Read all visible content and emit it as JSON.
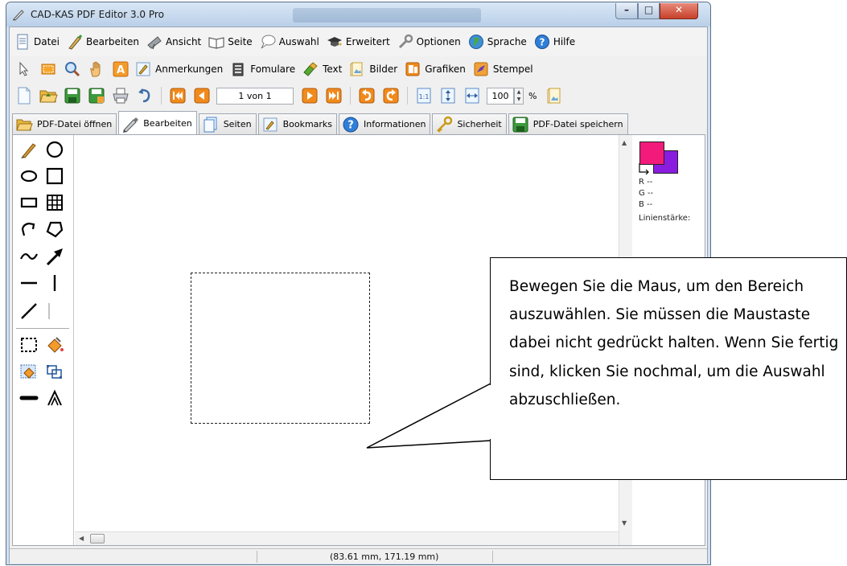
{
  "window": {
    "title": "CAD-KAS PDF Editor 3.0 Pro",
    "controls": [
      "minimize-icon",
      "maximize-icon",
      "close-icon"
    ]
  },
  "menu": [
    {
      "label": "Datei",
      "icon": "file-icon"
    },
    {
      "label": "Bearbeiten",
      "icon": "brush-icon"
    },
    {
      "label": "Ansicht",
      "icon": "telescope-icon"
    },
    {
      "label": "Seite",
      "icon": "book-icon"
    },
    {
      "label": "Auswahl",
      "icon": "speech-bubble-icon"
    },
    {
      "label": "Erweitert",
      "icon": "graduation-cap-icon"
    },
    {
      "label": "Optionen",
      "icon": "wrench-icon"
    },
    {
      "label": "Sprache",
      "icon": "globe-icon"
    },
    {
      "label": "Hilfe",
      "icon": "help-icon"
    }
  ],
  "toolbar1": {
    "icon_tools": [
      "cursor-icon",
      "rectangle-select-icon",
      "zoom-icon",
      "hand-icon",
      "text-a-icon"
    ],
    "labeled": [
      {
        "label": "Anmerkungen",
        "icon": "annotation-icon"
      },
      {
        "label": "Fomulare",
        "icon": "form-icon"
      },
      {
        "label": "Text",
        "icon": "text-tool-icon"
      },
      {
        "label": "Bilder",
        "icon": "image-icon"
      },
      {
        "label": "Grafiken",
        "icon": "graphics-icon"
      },
      {
        "label": "Stempel",
        "icon": "stamp-icon"
      }
    ]
  },
  "toolbar2": {
    "page_display": "1 von 1",
    "zoom_value": "100",
    "zoom_unit": "%"
  },
  "tabs": [
    {
      "label": "PDF-Datei öffnen",
      "icon": "folder-open-icon",
      "active": false
    },
    {
      "label": "Bearbeiten",
      "icon": "pencil-icon",
      "active": true
    },
    {
      "label": "Seiten",
      "icon": "pages-icon",
      "active": false
    },
    {
      "label": "Bookmarks",
      "icon": "bookmark-icon",
      "active": false
    },
    {
      "label": "Informationen",
      "icon": "info-icon",
      "active": false
    },
    {
      "label": "Sicherheit",
      "icon": "key-icon",
      "active": false
    },
    {
      "label": "PDF-Datei speichern",
      "icon": "save-icon",
      "active": false
    }
  ],
  "colors": {
    "foreground": "#f21a7b",
    "background": "#8a1ce0"
  },
  "right_panel": {
    "r": "R --",
    "g": "G --",
    "b": "B --",
    "line_width_label": "Linienstärke:"
  },
  "status": {
    "coordinates": "(83.61 mm, 171.19 mm)"
  },
  "callout": {
    "text": "Bewegen Sie die Maus, um den Bereich auszuwählen. Sie müssen die Maustaste dabei nicht gedrückt halten. Wenn Sie fertig sind, klicken Sie nochmal, um die Auswahl abzuschließen."
  }
}
